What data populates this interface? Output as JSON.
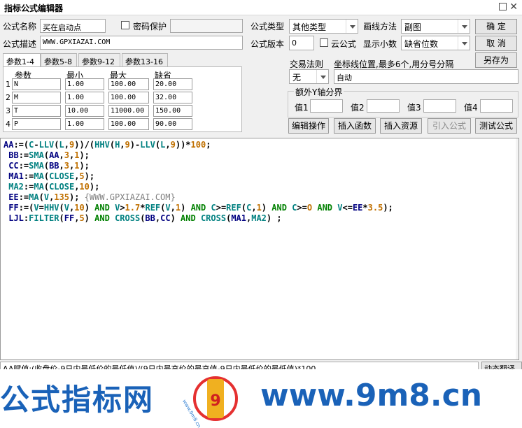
{
  "window": {
    "title": "指标公式编辑器"
  },
  "form": {
    "name_label": "公式名称",
    "name_value": "买在启动点",
    "password_label": "密码保护",
    "desc_label": "公式描述",
    "desc_value": "WWW.GPXIAZAI.COM",
    "type_label": "公式类型",
    "type_value": "其他类型",
    "draw_label": "画线方法",
    "draw_value": "副图",
    "version_label": "公式版本",
    "version_value": "0",
    "cloud_label": "云公式",
    "decimal_label": "显示小数",
    "decimal_value": "缺省位数",
    "trade_label": "交易法则",
    "trade_value": "无",
    "coord_label": "坐标线位置,最多6个,用分号分隔",
    "coord_value": "自动",
    "yaxis_group": "额外Y轴分界",
    "val1_label": "值1",
    "val2_label": "值2",
    "val3_label": "值3",
    "val4_label": "值4"
  },
  "buttons": {
    "ok": "确  定",
    "cancel": "取  消",
    "save_as": "另存为",
    "edit_ops": "编辑操作",
    "insert_func": "插入函数",
    "insert_res": "插入资源",
    "import_formula": "引入公式",
    "test_formula": "测试公式",
    "translate": "动态翻译"
  },
  "tabs": [
    "参数1-4",
    "参数5-8",
    "参数9-12",
    "参数13-16"
  ],
  "params": {
    "headers": [
      "参数",
      "最小",
      "最大",
      "缺省"
    ],
    "rows": [
      {
        "num": "1",
        "name": "N",
        "min": "1.00",
        "max": "100.00",
        "def": "20.00"
      },
      {
        "num": "2",
        "name": "M",
        "min": "1.00",
        "max": "100.00",
        "def": "32.00"
      },
      {
        "num": "3",
        "name": "T",
        "min": "10.00",
        "max": "11000.00",
        "def": "150.00"
      },
      {
        "num": "4",
        "name": "P",
        "min": "1.00",
        "max": "100.00",
        "def": "90.00"
      }
    ]
  },
  "code": {
    "comment": "{WWW.GPXIAZAI.COM}"
  },
  "status": "AA赋值:(收盘价-9日内最低价的最低值)/(9日内最高价的最高值-9日内最低价的最低值)*100",
  "banner": {
    "left_text": "公式指标网",
    "logo_text": "www.9m8.cn",
    "site_text": "www.9m8.cn"
  }
}
